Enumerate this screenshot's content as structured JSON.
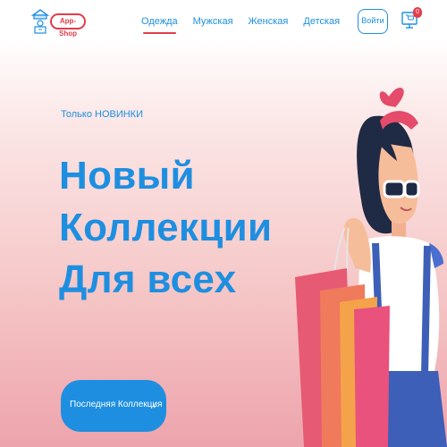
{
  "header": {
    "logo_text": "App-Shop",
    "nav": [
      {
        "label": "Одежда",
        "active": true
      },
      {
        "label": "Мужская",
        "active": false
      },
      {
        "label": "Женская",
        "active": false
      },
      {
        "label": "Детская",
        "active": false
      }
    ],
    "login_label": "Войти",
    "cart_count": "0"
  },
  "hero": {
    "eyebrow": "Только НОВИНКИ",
    "headline_lines": [
      "Новый",
      "Коллекции",
      "Для всех"
    ],
    "cta_label": "Последняя Коллекция",
    "cta_arrow": "→"
  },
  "icons": {
    "logo": "shop-stand-icon",
    "cart": "cart-monitor-icon",
    "cta_arrow": "arrow-right-icon"
  },
  "colors": {
    "accent_blue": "#1e8fe0",
    "accent_red": "#e23b4a"
  }
}
